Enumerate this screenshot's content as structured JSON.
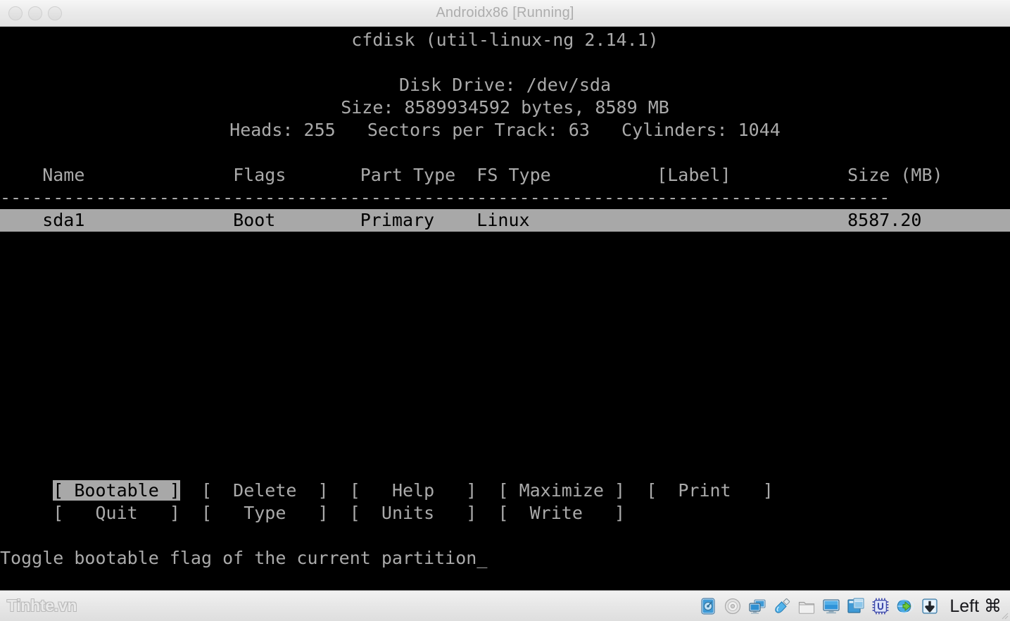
{
  "window": {
    "title": "Androidx86 [Running]",
    "traffic_lights": [
      "close-button",
      "minimize-button",
      "zoom-button"
    ]
  },
  "terminal": {
    "app_title": "cfdisk (util-linux-ng 2.14.1)",
    "disk_drive_line": "Disk Drive: /dev/sda",
    "size_line": "Size: 8589934592 bytes, 8589 MB",
    "geometry_line": "Heads: 255   Sectors per Track: 63   Cylinders: 1044",
    "columns": {
      "name": "Name",
      "flags": "Flags",
      "part_type": "Part Type",
      "fs_type": "FS Type",
      "label": "[Label]",
      "size": "Size (MB)"
    },
    "header_row": "    Name              Flags       Part Type  FS Type          [Label]           Size (MB)",
    "separator": "------------------------------------------------------------------------------------",
    "partitions": [
      {
        "name": "sda1",
        "flags": "Boot",
        "part_type": "Primary",
        "fs_type": "Linux",
        "label": "",
        "size_mb": "8587.20",
        "selected": true,
        "row_text": "    sda1              Boot        Primary    Linux                              8587.20"
      }
    ],
    "menu_row_1": [
      {
        "label": "Bootable",
        "text": "[ Bootable ]",
        "selected": true
      },
      {
        "label": "Delete",
        "text": "[  Delete  ]",
        "selected": false
      },
      {
        "label": "Help",
        "text": "[   Help   ]",
        "selected": false
      },
      {
        "label": "Maximize",
        "text": "[ Maximize ]",
        "selected": false
      },
      {
        "label": "Print",
        "text": "[  Print   ]",
        "selected": false
      }
    ],
    "menu_row_2": [
      {
        "label": "Quit",
        "text": "[   Quit   ]",
        "selected": false
      },
      {
        "label": "Type",
        "text": "[   Type   ]",
        "selected": false
      },
      {
        "label": "Units",
        "text": "[  Units   ]",
        "selected": false
      },
      {
        "label": "Write",
        "text": "[  Write   ]",
        "selected": false
      }
    ],
    "help_text": "Toggle bootable flag of the current partition",
    "cursor": "_",
    "colors": {
      "background": "#000000",
      "foreground": "#aaaaaa",
      "selection_background": "#a8a8a8",
      "selection_foreground": "#000000"
    }
  },
  "statusbar": {
    "watermark": "Tinhte.vn",
    "host_key": "Left ⌘",
    "icons": [
      {
        "name": "hard-disk-icon",
        "state": "active"
      },
      {
        "name": "cd-dvd-icon",
        "state": "inactive"
      },
      {
        "name": "network-icon",
        "state": "active"
      },
      {
        "name": "usb-icon",
        "state": "active"
      },
      {
        "name": "shared-folder-icon",
        "state": "inactive"
      },
      {
        "name": "display-icon",
        "state": "active"
      },
      {
        "name": "seamless-window-icon",
        "state": "active"
      },
      {
        "name": "cpu-icon",
        "state": "active"
      },
      {
        "name": "remote-display-icon",
        "state": "active"
      },
      {
        "name": "capture-icon",
        "state": "active"
      }
    ]
  }
}
